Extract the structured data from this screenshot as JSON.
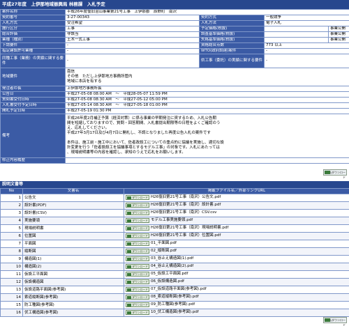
{
  "header": {
    "title": "平成27年度　上伊那地域振興局 林務課　入札予定"
  },
  "info_rows": [
    {
      "label": "案件名称",
      "value": "平成26年度復旧治山事業第21号工事　上伊那郡　辰野町　南沢"
    },
    {
      "label": "契約番号",
      "value": "3-27-00343",
      "label2": "契約方式",
      "value2": "一般競争"
    },
    {
      "label": "入札方式",
      "value": "受注希望",
      "label2": "入札方法",
      "value2": "電子入札"
    },
    {
      "label": "施行区分",
      "value": "工事",
      "label2": "予定価格(税抜)",
      "value2": ""
    },
    {
      "label": "総合評価",
      "value": "非該当",
      "label2": "調査基準価格(税抜)",
      "value2": ""
    },
    {
      "label": "業種（種別）",
      "value": "土木一式工事",
      "label2": "失格基準価格(税抜)",
      "value2": ""
    },
    {
      "label": "下請要件",
      "value": "-",
      "label2": "資格総合点数",
      "value2": "773 以上"
    },
    {
      "label": "指定建設許可業種",
      "value": "-",
      "label2": "WTO(政府調達)案件",
      "value2": "-"
    },
    {
      "label": "同種工事（業務）の実績に関する要件",
      "value": "-",
      "label2": "県工事（委託）の実績に関する要件",
      "value2": "-"
    }
  ],
  "side_col": [
    "事業公開",
    "事業公開",
    "事業公開"
  ],
  "region_requirement": {
    "label": "地域要件",
    "lines": [
      "南信",
      "その他　ただし上伊那地方事務所管内",
      "地域に本店を有する"
    ]
  },
  "office": {
    "label": "発注者の長",
    "value": "上伊那地方事務所長"
  },
  "schedule": [
    {
      "label": "公告日",
      "value": "平成27-05-08 08:00 AM　～　平成28-05-07 11:59 PM"
    },
    {
      "label": "質問書受付日時",
      "value": "平成27-05-08 08:30 AM　～　平成27-05-12 05:00 PM"
    },
    {
      "label": "入札書受付予定日時",
      "value": "平成27-05-14 08:30 AM　～　平成27-05-18 01:00 PM"
    },
    {
      "label": "開札予定日時",
      "value": "平成27-05-19 01:30 PM"
    }
  ],
  "remarks": {
    "label": "備考",
    "lines": [
      "平成26年度2月補正予算（経済対策）に係る事業の早期発注に資するため、入札公告期",
      "間を短縮しておりますので、質問・回答期間、入札書提出期限等の日程をよくご確認のう",
      "え、応札してください。",
      "平成27年3月17日及び4月7日に開札し、不調となりました再度公告入札の案件です",
      "",
      "本件は、施工前・施工中において、佐者政設工についての重点的に協議を実施し、適切な設",
      "計変更を行う「佐者設設工を協議事項とするモデル工事」の対象です。入札にあたっては",
      "、現場説明書等の内容を確認し、承知のうえで応札をお願いします。"
    ]
  },
  "revision": {
    "label": "修正内容履歴",
    "value": ""
  },
  "download_all_label": "一括ダウンロード",
  "documents": {
    "title": "説明文書等",
    "columns": [
      "No",
      "文書名",
      "掲載ファイル名／外部リンクURL"
    ],
    "button_label": "ダウンロード",
    "rows": [
      {
        "no": "1",
        "name": "公告文",
        "file": "H26復旧第21号工事（南沢）公告文.pdf"
      },
      {
        "no": "2",
        "name": "設計書(PDF)",
        "file": "H26復旧第21号工事（南沢）設計書.pdf"
      },
      {
        "no": "3",
        "name": "設計書(CSV)",
        "file": "H26復旧第21号工事（南沢）CSV.csv"
      },
      {
        "no": "4",
        "name": "実施要領",
        "file": "モデル工事実施要領.pdf"
      },
      {
        "no": "5",
        "name": "現場説明書",
        "file": "H26復旧第21号工事（南沢）現場説明書.pdf"
      },
      {
        "no": "6",
        "name": "位置図",
        "file": "H26復旧第21号工事（南沢）位置図.pdf"
      },
      {
        "no": "7",
        "name": "平面図",
        "file": "01_平面図.pdf"
      },
      {
        "no": "8",
        "name": "縦断図",
        "file": "02_縦断図.pdf"
      },
      {
        "no": "9",
        "name": "構造図(1)",
        "file": "03_谷止え構造図(1).pdf"
      },
      {
        "no": "10",
        "name": "構造図(2)",
        "file": "04_谷止え構造図(2).pdf"
      },
      {
        "no": "11",
        "name": "仮設工平面図",
        "file": "05_仮設工平面図.pdf"
      },
      {
        "no": "12",
        "name": "仮設構造図",
        "file": "06_仮設構造図.pdf"
      },
      {
        "no": "13",
        "name": "仮設道路平面図(参考図)",
        "file": "07_仮設道路平面図(参考図).pdf"
      },
      {
        "no": "14",
        "name": "索道縦断図(参考図)",
        "file": "08_索道縦断図(参考図).pdf"
      },
      {
        "no": "15",
        "name": "防工種図(参考図)",
        "file": "09_防工種図(参考図).pdf"
      },
      {
        "no": "16",
        "name": "伏工構造図(参考図)",
        "file": "10_伏工構造図(参考図).pdf"
      }
    ]
  }
}
